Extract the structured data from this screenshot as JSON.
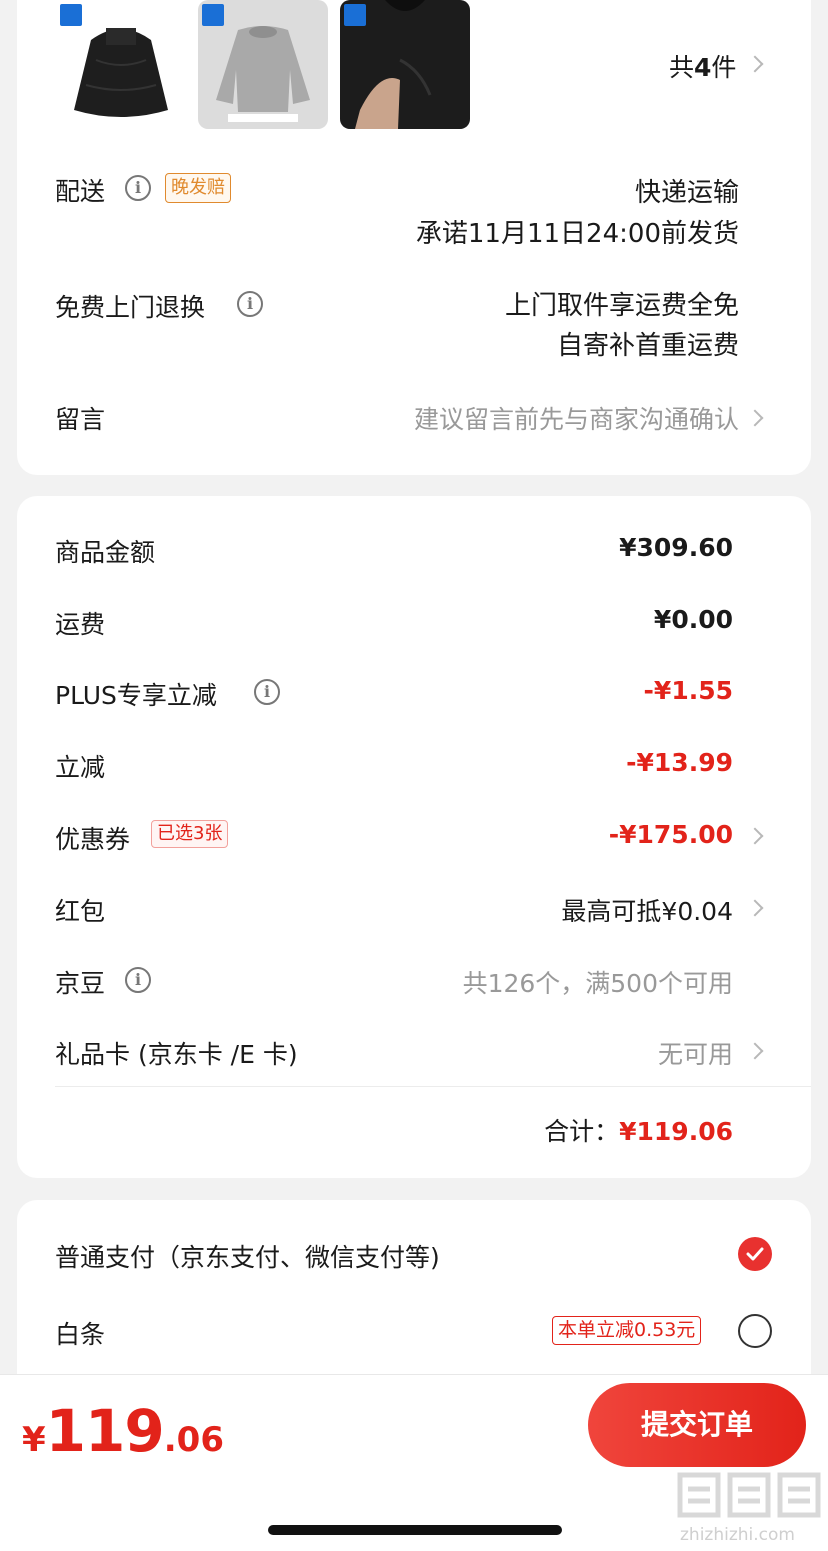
{
  "products": {
    "total_prefix": "共",
    "total_count": "4",
    "total_suffix": "件",
    "thumbnails": [
      "down-jacket-black",
      "sweater-gray",
      "mockneck-black"
    ]
  },
  "delivery": {
    "label": "配送",
    "tag": "晚发赔",
    "method": "快递运输",
    "promise": "承诺11月11日24:00前发货"
  },
  "returns": {
    "label": "免费上门退换",
    "line1": "上门取件享运费全免",
    "line2": "自寄补首重运费"
  },
  "message": {
    "label": "留言",
    "placeholder": "建议留言前先与商家沟通确认"
  },
  "summary": {
    "goods_label": "商品金额",
    "goods_value": "¥309.60",
    "shipping_label": "运费",
    "shipping_value": "¥0.00",
    "plus_label": "PLUS专享立减",
    "plus_value": "-¥1.55",
    "instant_label": "立减",
    "instant_value": "-¥13.99",
    "coupon_label": "优惠券",
    "coupon_tag": "已选3张",
    "coupon_value": "-¥175.00",
    "redpacket_label": "红包",
    "redpacket_value": "最高可抵¥0.04",
    "beans_label": "京豆",
    "beans_value": "共126个，满500个可用",
    "giftcard_label": "礼品卡 (京东卡 /E 卡)",
    "giftcard_value": "无可用",
    "total_label": "合计：",
    "total_value": "¥119.06"
  },
  "payment": {
    "normal_label": "普通支付（京东支付、微信支付等)",
    "baitiao_label": "白条",
    "baitiao_promo": "本单立减0.53元"
  },
  "bottom": {
    "currency": "¥",
    "integer": "119",
    "decimal": ".06",
    "submit_label": "提交订单"
  },
  "watermark": "zhizhizhi.com",
  "colors": {
    "accent_red": "#e2231a",
    "tag_orange": "#e08a2e",
    "checked": "#e8312f"
  }
}
